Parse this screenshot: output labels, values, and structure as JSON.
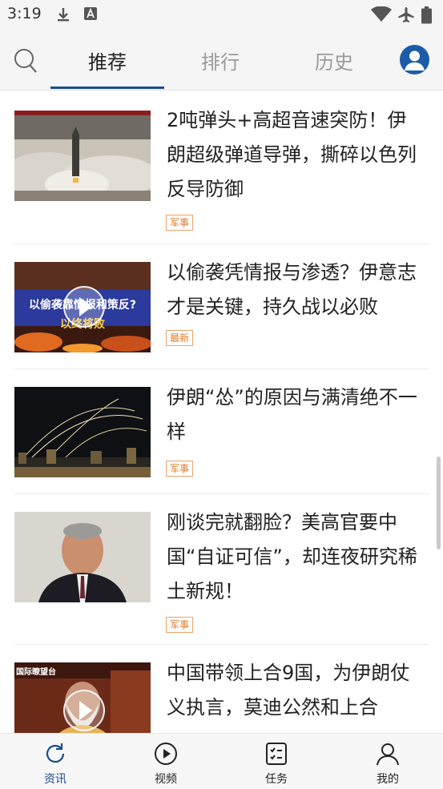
{
  "status_bar": {
    "time": "3:19"
  },
  "top_nav": {
    "tabs": [
      {
        "label": "推荐",
        "active": true
      },
      {
        "label": "排行",
        "active": false
      },
      {
        "label": "历史",
        "active": false
      }
    ]
  },
  "feed": [
    {
      "title": "2吨弹头+高超音速突防！伊朗超级弹道导弹，撕碎以色列反导防御",
      "tag": "军事"
    },
    {
      "title": "以偷袭凭情报与渗透？伊意志才是关键，持久战以必败",
      "tag": "最新",
      "thumb_text": [
        "以偷袭靠情报和策反?",
        "以终将败"
      ]
    },
    {
      "title": "伊朗“怂”的原因与满清绝不一样",
      "tag": "军事"
    },
    {
      "title": "刚谈完就翻脸？美高官要中国“自证可信”，却连夜研究稀土新规！",
      "tag": "军事"
    },
    {
      "title": "中国带领上合9国，为伊朗仗义执言，莫迪公然和上合",
      "thumb_text": [
        "国际瞭望台"
      ]
    }
  ],
  "bottom_nav": [
    {
      "label": "资讯",
      "icon": "refresh-icon",
      "active": true
    },
    {
      "label": "视频",
      "icon": "play-circle-icon",
      "active": false
    },
    {
      "label": "任务",
      "icon": "task-list-icon",
      "active": false
    },
    {
      "label": "我的",
      "icon": "user-icon",
      "active": false
    }
  ],
  "colors": {
    "accent": "#1a4d8f",
    "tag": "#e07b2a"
  }
}
